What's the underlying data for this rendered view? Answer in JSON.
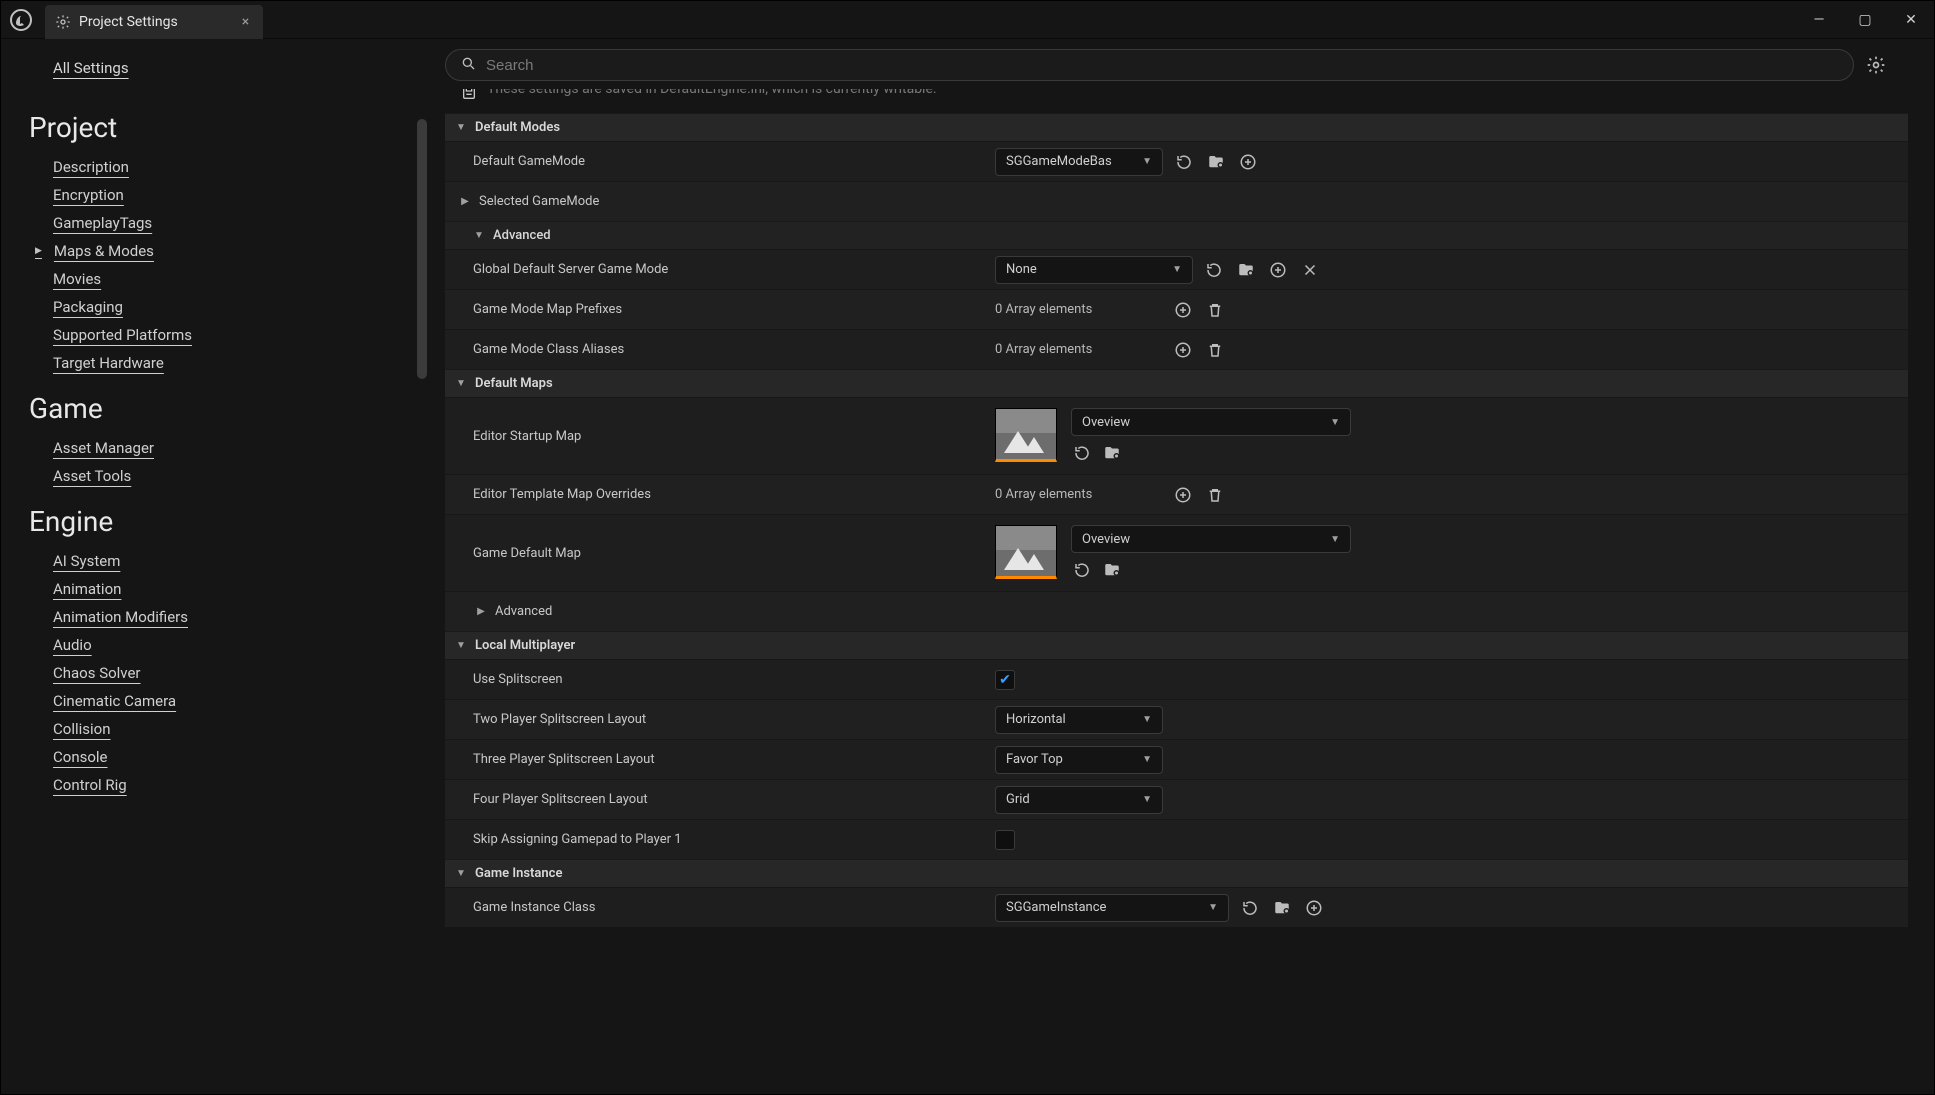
{
  "window": {
    "tab_title": "Project Settings",
    "search_placeholder": "Search"
  },
  "banner": "These settings are saved in DefaultEngine.ini, which is currently writable.",
  "sidebar": {
    "all_settings": "All Settings",
    "groups": [
      {
        "title": "Project",
        "items": [
          {
            "label": "Description",
            "selected": false
          },
          {
            "label": "Encryption",
            "selected": false
          },
          {
            "label": "GameplayTags",
            "selected": false
          },
          {
            "label": "Maps & Modes",
            "selected": true
          },
          {
            "label": "Movies",
            "selected": false
          },
          {
            "label": "Packaging",
            "selected": false
          },
          {
            "label": "Supported Platforms",
            "selected": false
          },
          {
            "label": "Target Hardware",
            "selected": false
          }
        ]
      },
      {
        "title": "Game",
        "items": [
          {
            "label": "Asset Manager",
            "selected": false
          },
          {
            "label": "Asset Tools",
            "selected": false
          }
        ]
      },
      {
        "title": "Engine",
        "items": [
          {
            "label": "AI System",
            "selected": false
          },
          {
            "label": "Animation",
            "selected": false
          },
          {
            "label": "Animation Modifiers",
            "selected": false
          },
          {
            "label": "Audio",
            "selected": false
          },
          {
            "label": "Chaos Solver",
            "selected": false
          },
          {
            "label": "Cinematic Camera",
            "selected": false
          },
          {
            "label": "Collision",
            "selected": false
          },
          {
            "label": "Console",
            "selected": false
          },
          {
            "label": "Control Rig",
            "selected": false
          }
        ]
      }
    ]
  },
  "sections": {
    "default_modes": {
      "title": "Default Modes",
      "default_gamemode_label": "Default GameMode",
      "default_gamemode_value": "SGGameModeBas",
      "selected_gamemode_label": "Selected GameMode",
      "advanced_label": "Advanced",
      "global_server_label": "Global Default Server Game Mode",
      "global_server_value": "None",
      "prefixes_label": "Game Mode Map Prefixes",
      "prefixes_value": "0 Array elements",
      "aliases_label": "Game Mode Class Aliases",
      "aliases_value": "0 Array elements"
    },
    "default_maps": {
      "title": "Default Maps",
      "editor_startup_label": "Editor Startup Map",
      "editor_startup_value": "Oveview",
      "overrides_label": "Editor Template Map Overrides",
      "overrides_value": "0 Array elements",
      "game_default_label": "Game Default Map",
      "game_default_value": "Oveview",
      "advanced_label": "Advanced"
    },
    "local_mp": {
      "title": "Local Multiplayer",
      "use_split_label": "Use Splitscreen",
      "use_split_checked": true,
      "two_label": "Two Player Splitscreen Layout",
      "two_value": "Horizontal",
      "three_label": "Three Player Splitscreen Layout",
      "three_value": "Favor Top",
      "four_label": "Four Player Splitscreen Layout",
      "four_value": "Grid",
      "skip_label": "Skip Assigning Gamepad to Player 1",
      "skip_checked": false
    },
    "game_instance": {
      "title": "Game Instance",
      "class_label": "Game Instance Class",
      "class_value": "SGGameInstance"
    }
  }
}
